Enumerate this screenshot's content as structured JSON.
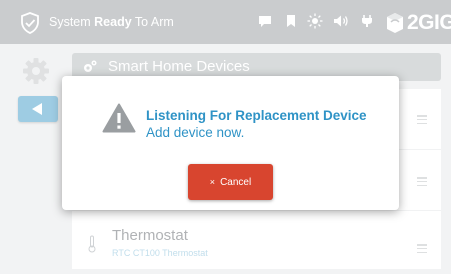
{
  "topbar": {
    "status_prefix": "System ",
    "status_bold": "Ready",
    "status_suffix": " To Arm",
    "icons": [
      "chat-icon",
      "bookmark-icon",
      "brightness-icon",
      "volume-icon",
      "plug-icon"
    ],
    "brand": "2GIG"
  },
  "panel": {
    "title": "Smart Home Devices"
  },
  "devices": [
    {
      "title": "",
      "subtitle": ""
    },
    {
      "title": "",
      "subtitle": ""
    },
    {
      "title": "Thermostat",
      "subtitle": "RTC CT100 Thermostat"
    }
  ],
  "dialog": {
    "title": "Listening For Replacement Device",
    "message": "Add device now.",
    "cancel_icon": "×",
    "cancel_label": "Cancel"
  },
  "colors": {
    "topbar": "#9ea3a7",
    "accent_blue": "#2f93c6",
    "back_button": "#4fa3cc",
    "cancel_red": "#d8452f"
  }
}
